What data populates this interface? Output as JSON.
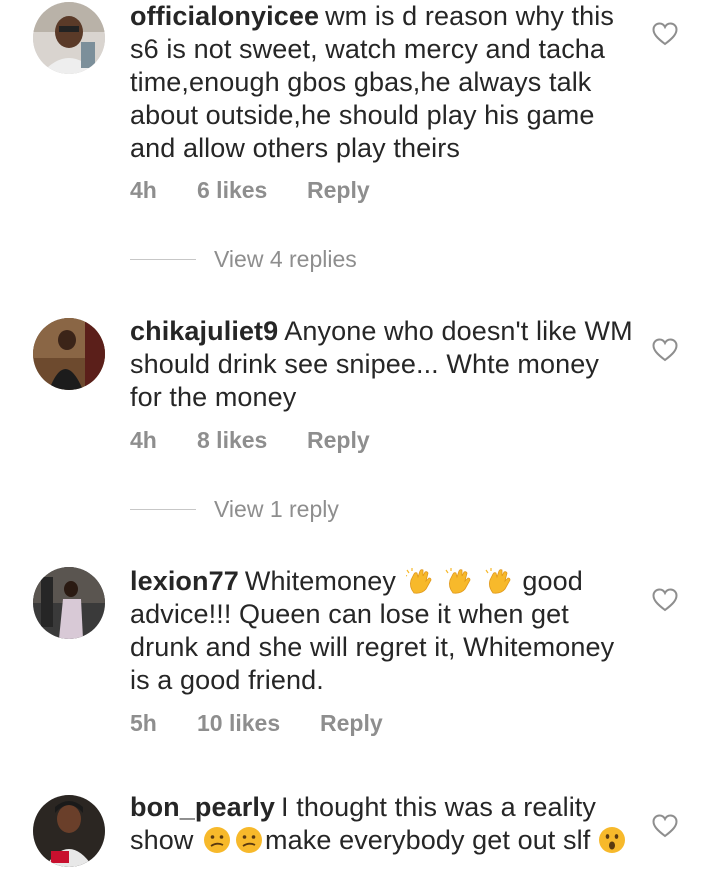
{
  "comments": [
    {
      "username": "officialonyicee",
      "text": "wm is d reason why this s6 is not sweet, watch mercy and tacha time,enough gbos gbas,he always talk about outside,he should play his game and allow others play theirs",
      "time": "4h",
      "likes": "6 likes",
      "reply": "Reply",
      "view_replies": "View 4 replies"
    },
    {
      "username": "chikajuliet9",
      "text": "Anyone who doesn't like WM should drink see snipee... Whte money for the money",
      "time": "4h",
      "likes": "8 likes",
      "reply": "Reply",
      "view_replies": "View 1 reply"
    },
    {
      "username": "lexion77",
      "text_before_emoji": "Whitemoney",
      "emojis": [
        "clapping-hands",
        "clapping-hands",
        "clapping-hands"
      ],
      "text_after_emoji": "good advice!!! Queen can lose it when get drunk and she will regret it, Whitemoney is a good friend.",
      "time": "5h",
      "likes": "10 likes",
      "reply": "Reply"
    },
    {
      "username": "bon_pearly",
      "text_before_emoji": "I thought this was a reality show",
      "emojis": [
        "confused-face",
        "confused-face",
        "astonished-face"
      ],
      "text_after_emoji": "make everybody get out slf"
    }
  ],
  "colors": {
    "text": "#262626",
    "muted": "#8e8e8e",
    "divider": "#c7c7c7",
    "emoji": "#f7b92b"
  },
  "icons": [
    "heart-outline-icon",
    "avatar"
  ]
}
